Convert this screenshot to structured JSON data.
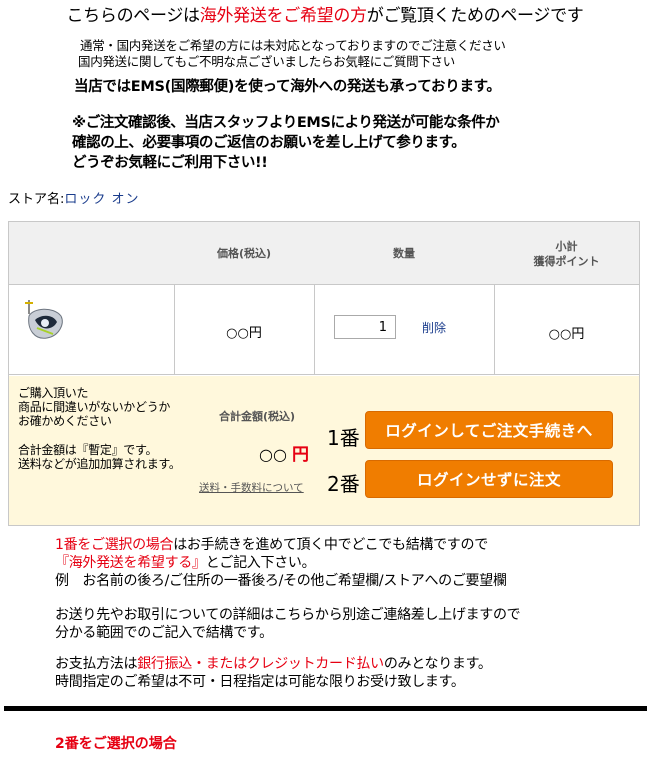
{
  "header": {
    "title_prefix": "こちらのページは",
    "title_red": "海外発送をご希望の方",
    "title_suffix": "がご覧頂くためのページです",
    "notice_line1": "通常・国内発送をご希望の方には未対応となっておりますのでご注意ください",
    "notice_line2": "国内発送に関してもご不明な点ございましたらお気軽にご質問下さい",
    "ems_line": "当店ではEMS(国際郵便)を使って海外への発送も承っております。",
    "confirm_line1": "※ご注文確認後、当店スタッフよりEMSにより発送が可能な条件か",
    "confirm_line2": "確認の上、必要事項のご返信のお願いを差し上げて参ります。",
    "confirm_line3": "どうぞお気軽にご利用下さい!!"
  },
  "store": {
    "label": "ストア名:",
    "name": "ロック オン"
  },
  "cart": {
    "columns": {
      "price": "価格(税込)",
      "qty": "数量",
      "subtotal": "小計",
      "points": "獲得ポイント"
    },
    "item": {
      "image_icon": "golf-driver-icon",
      "price": "○○円",
      "quantity": "1",
      "delete": "削除",
      "subtotal": "○○円"
    },
    "summary": {
      "note1_line1": "ご購入頂いた",
      "note1_line2": "商品に間違いがないかどうか",
      "note1_line3": "お確かめください",
      "note2_line1": "合計金額は『暫定』です。",
      "note2_line2": "送料などが追加加算されます。",
      "total_label": "合計金額(税込)",
      "total_value": "○○",
      "total_unit": "円",
      "shipping_link": "送料・手数料について",
      "num1": "1番",
      "num2": "2番",
      "login_checkout": "ログインしてご注文手続きへ",
      "guest_checkout": "ログインせずに注文"
    }
  },
  "info": {
    "p1_red": "1番をご選択の場合",
    "p1_rest": "はお手続きを進めて頂く中でどこでも結構ですので",
    "p1_red2": "『海外発送を希望する』",
    "p1_rest2": "とご記入下さい。",
    "p1_example": "例　お名前の後ろ/ご住所の一番後ろ/その他ご希望欄/ストアへのご要望欄",
    "p2_line1": "お送り先やお取引についての詳細はこちらから別途ご連絡差し上げますので",
    "p2_line2": "分かる範囲でのご記入で結構です。",
    "p3_prefix": "お支払方法は",
    "p3_red": "銀行振込・またはクレジットカード払い",
    "p3_suffix": "のみとなります。",
    "p3_line2": "時間指定のご希望は不可・日程指定は可能な限りお受け致します。",
    "option2": "2番をご選択の場合"
  },
  "colors": {
    "accent_red": "#e60012",
    "button_orange": "#f07d00",
    "link_blue": "#1a3c8c",
    "summary_bg": "#fff8dc"
  }
}
